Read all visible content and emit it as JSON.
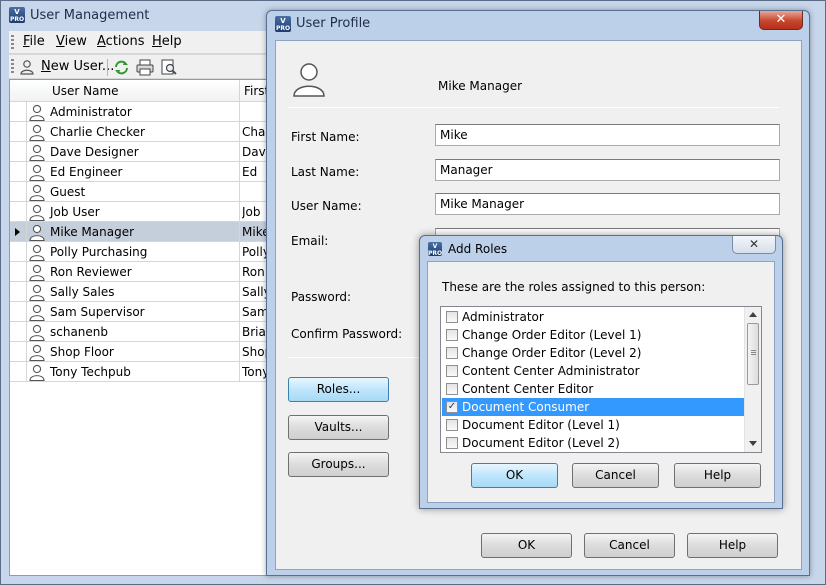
{
  "main_window": {
    "title": "User Management",
    "menu": [
      {
        "label": "File",
        "u": "F",
        "rest": "ile"
      },
      {
        "label": "View",
        "u": "V",
        "rest": "iew"
      },
      {
        "label": "Actions",
        "u": "A",
        "rest": "ctions"
      },
      {
        "label": "Help",
        "u": "H",
        "rest": "elp"
      }
    ],
    "toolbar": {
      "new_user_u": "N",
      "new_user_rest": "ew User...",
      "icons": [
        "refresh-icon",
        "print-icon",
        "print-preview-icon"
      ]
    },
    "grid": {
      "columns": [
        "User Name",
        "First"
      ],
      "rows": [
        {
          "name": "Administrator",
          "first": ""
        },
        {
          "name": "Charlie Checker",
          "first": "Charlie"
        },
        {
          "name": "Dave Designer",
          "first": "Dave"
        },
        {
          "name": "Ed Engineer",
          "first": "Ed"
        },
        {
          "name": "Guest",
          "first": ""
        },
        {
          "name": "Job User",
          "first": "Job"
        },
        {
          "name": "Mike Manager",
          "first": "Mike",
          "selected": true
        },
        {
          "name": "Polly Purchasing",
          "first": "Polly"
        },
        {
          "name": "Ron Reviewer",
          "first": "Ron"
        },
        {
          "name": "Sally Sales",
          "first": "Sally"
        },
        {
          "name": "Sam Supervisor",
          "first": "Sam"
        },
        {
          "name": "schanenb",
          "first": "Brian"
        },
        {
          "name": "Shop Floor",
          "first": "Shop"
        },
        {
          "name": "Tony Techpub",
          "first": "Tony"
        }
      ]
    }
  },
  "profile_dialog": {
    "title": "User Profile",
    "close_label": "✕",
    "header_name": "Mike Manager",
    "fields": {
      "first_name": {
        "label": "First Name:",
        "value": "Mike"
      },
      "last_name": {
        "label": "Last Name:",
        "value": "Manager"
      },
      "user_name": {
        "label": "User Name:",
        "value": "Mike Manager"
      },
      "email": {
        "label": "Email:",
        "value": ""
      },
      "password": {
        "label": "Password:"
      },
      "confirm_password": {
        "label": "Confirm Password:"
      }
    },
    "side_buttons": {
      "roles": "Roles...",
      "vaults": "Vaults...",
      "groups": "Groups..."
    },
    "footer_buttons": {
      "ok": "OK",
      "cancel": "Cancel",
      "help": "Help"
    }
  },
  "roles_dialog": {
    "title": "Add Roles",
    "close_label": "✕",
    "instruction": "These are the roles assigned to this person:",
    "roles": [
      {
        "label": "Administrator",
        "checked": false,
        "selected": false
      },
      {
        "label": "Change Order Editor (Level 1)",
        "checked": false,
        "selected": false
      },
      {
        "label": "Change Order Editor (Level 2)",
        "checked": false,
        "selected": false
      },
      {
        "label": "Content Center Administrator",
        "checked": false,
        "selected": false
      },
      {
        "label": "Content Center Editor",
        "checked": false,
        "selected": false
      },
      {
        "label": "Document Consumer",
        "checked": true,
        "selected": true
      },
      {
        "label": "Document Editor (Level 1)",
        "checked": false,
        "selected": false
      },
      {
        "label": "Document Editor (Level 2)",
        "checked": false,
        "selected": false
      }
    ],
    "buttons": {
      "ok": "OK",
      "cancel": "Cancel",
      "help": "Help"
    }
  },
  "colors": {
    "selection": "#3399ff",
    "grid_selection": "#c5cfdb",
    "window_frame": "#bcd0ea"
  }
}
